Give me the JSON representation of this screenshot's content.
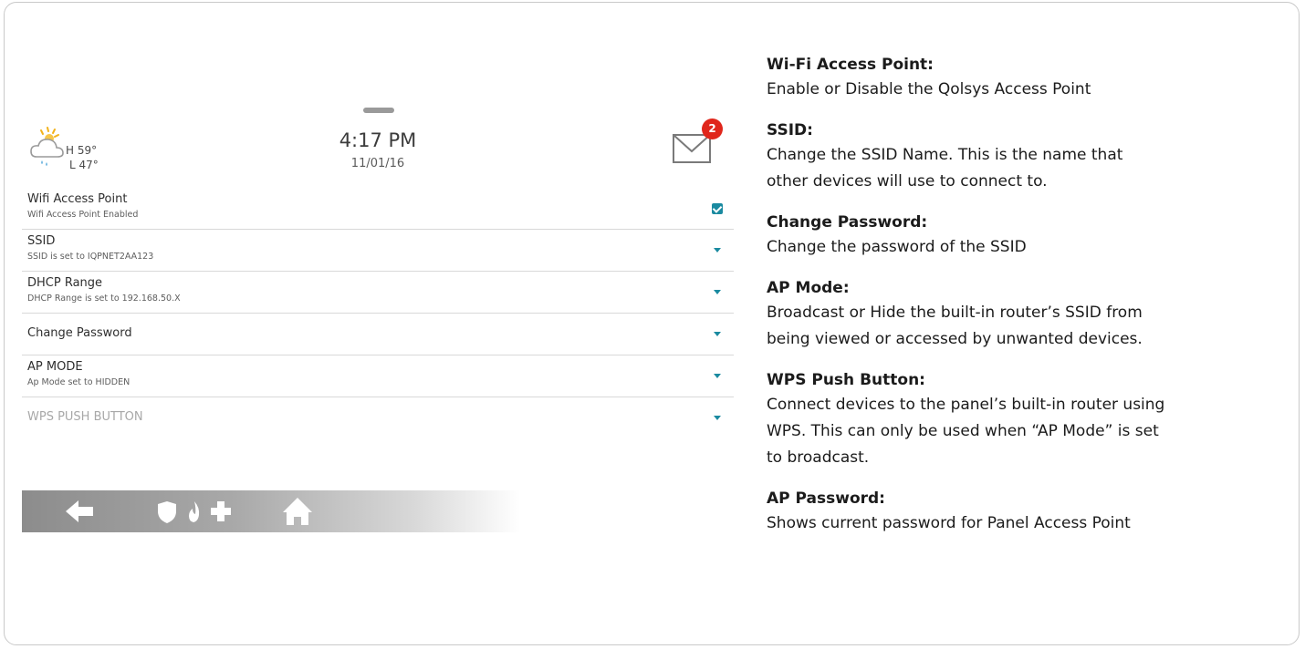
{
  "panel": {
    "weather": {
      "high": "H 59°",
      "low": "L 47°",
      "icon": "cloud-sun-rain-icon"
    },
    "clock": {
      "time": "4:17 PM",
      "date": "11/01/16"
    },
    "messages": {
      "icon": "mail-icon",
      "count": "2"
    },
    "settings": [
      {
        "title": "Wifi Access Point",
        "subtitle": "Wifi Access Point Enabled",
        "control": "checkbox",
        "checked": true
      },
      {
        "title": "SSID",
        "subtitle": "SSID is set to IQPNET2AA123",
        "control": "dropdown"
      },
      {
        "title": "DHCP Range",
        "subtitle": "DHCP Range is set to 192.168.50.X",
        "control": "dropdown"
      },
      {
        "title": "Change Password",
        "subtitle": "",
        "control": "dropdown"
      },
      {
        "title": "AP MODE",
        "subtitle": "Ap Mode set to HIDDEN",
        "control": "dropdown"
      },
      {
        "title": "WPS PUSH BUTTON",
        "subtitle": "",
        "control": "dropdown",
        "disabled": true
      }
    ],
    "navbar": [
      "back-arrow-icon",
      "shield-icon",
      "fire-icon",
      "plus-icon",
      "home-icon"
    ],
    "accent_color": "#1a8aa0",
    "badge_color": "#e0261b"
  },
  "help": [
    {
      "title": "Wi-Fi Access Point:",
      "desc_lines": [
        "Enable or Disable the Qolsys Access Point"
      ]
    },
    {
      "title": "SSID:",
      "desc_lines": [
        "Change the SSID Name. This is the name that",
        "other devices will use to connect to."
      ]
    },
    {
      "title": "Change Password:",
      "desc_lines": [
        "Change the password of the SSID"
      ]
    },
    {
      "title": "AP Mode:",
      "desc_lines": [
        "Broadcast or Hide the built-in router’s SSID from",
        "being viewed or accessed by unwanted devices."
      ]
    },
    {
      "title": "WPS Push Button:",
      "desc_lines": [
        "Connect devices to the panel’s built-in router using",
        "WPS. This can only be used when “AP Mode” is set",
        "to broadcast."
      ]
    },
    {
      "title": "AP Password:",
      "desc_lines": [
        "Shows current password for Panel Access Point"
      ]
    }
  ]
}
